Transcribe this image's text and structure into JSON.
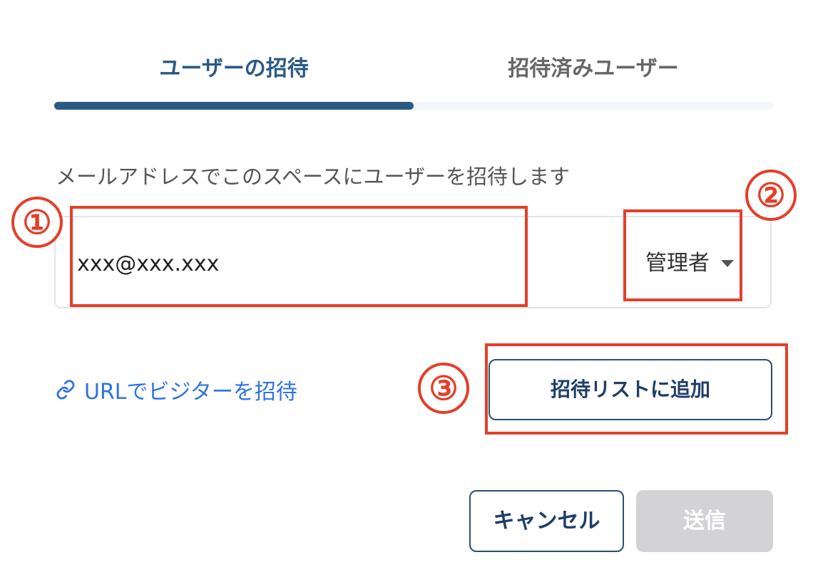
{
  "tabs": [
    {
      "label": "ユーザーの招待",
      "active": true
    },
    {
      "label": "招待済みユーザー",
      "active": false
    }
  ],
  "description": "メールアドレスでこのスペースにユーザーを招待します",
  "email_input": {
    "value": "xxx@xxx.xxx"
  },
  "role_select": {
    "selected": "管理者"
  },
  "url_invite_link": "URLでビジターを招待",
  "add_to_list_button": "招待リストに追加",
  "cancel_button": "キャンセル",
  "send_button": "送信",
  "annotations": [
    "①",
    "②",
    "③"
  ],
  "colors": {
    "accent": "#2b5a85",
    "link": "#2f73e0",
    "annotation": "#e2402a",
    "disabled": "#d3d3d6"
  },
  "icons": {
    "url_link": "link-icon",
    "role_dropdown": "caret-down-icon"
  }
}
